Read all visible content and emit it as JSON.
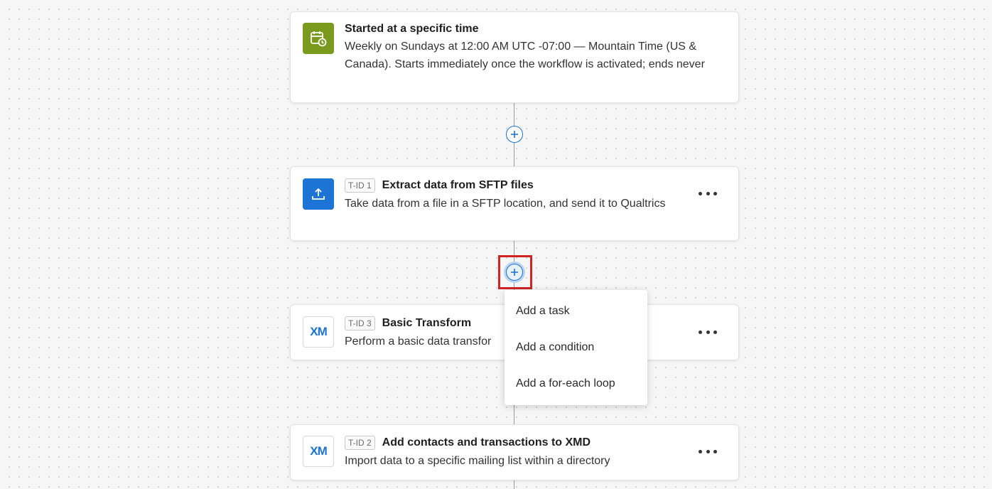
{
  "trigger": {
    "icon": "calendar-clock-icon",
    "title": "Started at a specific time",
    "description": "Weekly on Sundays at 12:00 AM UTC -07:00 — Mountain Time (US & Canada). Starts immediately once the workflow is activated; ends never"
  },
  "tasks": [
    {
      "icon": "upload-icon",
      "tid": "T-ID 1",
      "title": "Extract data from SFTP files",
      "description": "Take data from a file in a SFTP location, and send it to Qualtrics"
    },
    {
      "icon": "xm-logo-icon",
      "icon_text": "XM",
      "tid": "T-ID 3",
      "title": "Basic Transform",
      "description": "Perform a basic data transfor"
    },
    {
      "icon": "xm-logo-icon",
      "icon_text": "XM",
      "tid": "T-ID 2",
      "title": "Add contacts and transactions to XMD",
      "description": "Import data to a specific mailing list within a directory"
    }
  ],
  "add_menu": {
    "items": [
      "Add a task",
      "Add a condition",
      "Add a for-each loop"
    ]
  },
  "colors": {
    "accent": "#1b74d6",
    "trigger_icon_bg": "#7a9a1e",
    "highlight": "#d02424"
  }
}
